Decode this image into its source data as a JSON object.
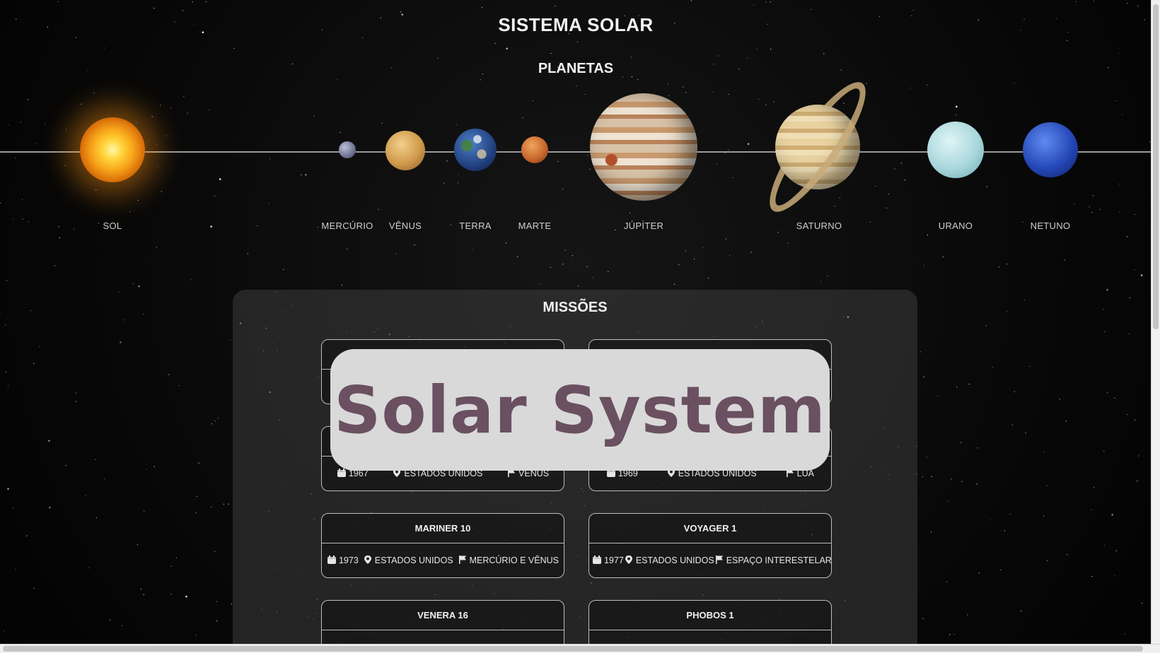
{
  "page": {
    "title": "SISTEMA SOLAR",
    "planets_heading": "PLANETAS",
    "missions_heading": "MISSÕES"
  },
  "bodies": [
    {
      "id": "sun",
      "label": "SOL"
    },
    {
      "id": "mercury",
      "label": "MERCÚRIO"
    },
    {
      "id": "venus",
      "label": "VÊNUS"
    },
    {
      "id": "earth",
      "label": "TERRA"
    },
    {
      "id": "mars",
      "label": "MARTE"
    },
    {
      "id": "jupiter",
      "label": "JÚPITER"
    },
    {
      "id": "saturn",
      "label": "SATURNO"
    },
    {
      "id": "uranus",
      "label": "URANO"
    },
    {
      "id": "neptune",
      "label": "NETUNO"
    }
  ],
  "missions": [
    {
      "name": "",
      "year": "",
      "country": "",
      "target": ""
    },
    {
      "name": "",
      "year": "",
      "country": "",
      "target": ""
    },
    {
      "name": "",
      "year": "1967",
      "country": "ESTADOS UNIDOS",
      "target": "VÊNUS"
    },
    {
      "name": "",
      "year": "1969",
      "country": "ESTADOS UNIDOS",
      "target": "LUA"
    },
    {
      "name": "MARINER 10",
      "year": "1973",
      "country": "ESTADOS UNIDOS",
      "target": "MERCÚRIO E VÊNUS"
    },
    {
      "name": "VOYAGER 1",
      "year": "1977",
      "country": "ESTADOS UNIDOS",
      "target": "ESPAÇO INTERESTELAR"
    },
    {
      "name": "VENERA 16",
      "year": "",
      "country": "",
      "target": ""
    },
    {
      "name": "PHOBOS 1",
      "year": "",
      "country": "",
      "target": ""
    }
  ],
  "overlay": {
    "text": "Solar System"
  },
  "icons": {
    "year": "calendar-icon",
    "country": "map-pin-icon",
    "target": "flag-icon"
  }
}
